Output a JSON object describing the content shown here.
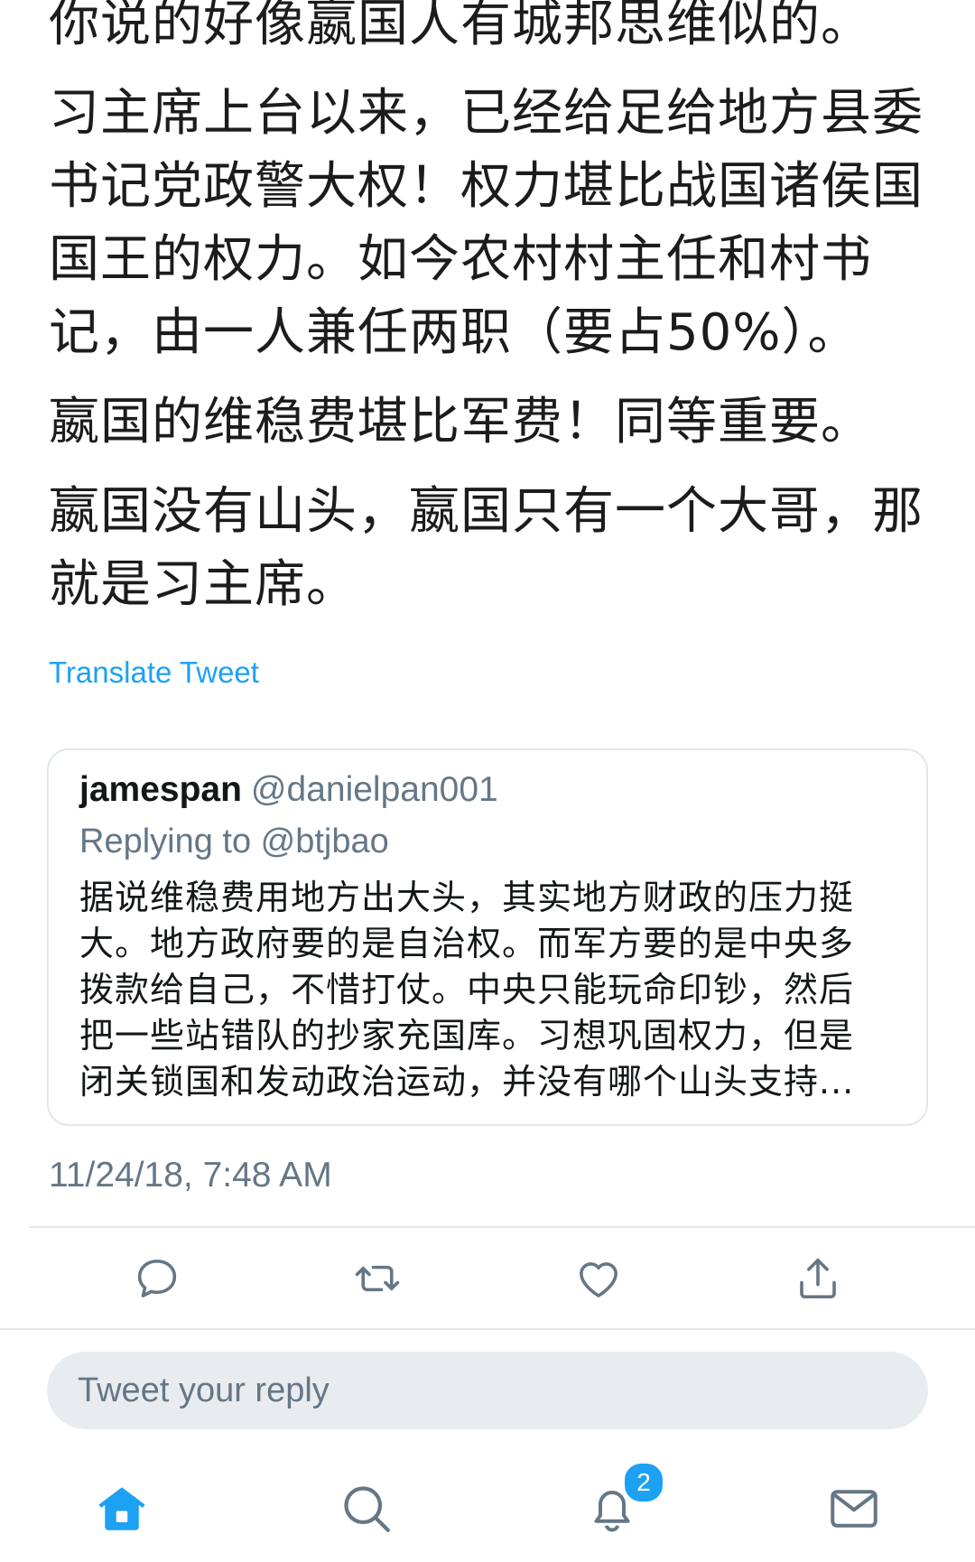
{
  "tweet": {
    "paragraphs": [
      "你说的好像嬴国人有城邦思维似的。",
      "习主席上台以来，已经给足给地方县委书记党政警大权！权力堪比战国诸侯国国王的权力。如今农村村主任和村书记，由一人兼任两职（要占50%）。",
      "嬴国的维稳费堪比军费！同等重要。",
      "嬴国没有山头，嬴国只有一个大哥，那就是习主席。"
    ],
    "translate_label": "Translate Tweet",
    "timestamp": "11/24/18, 7:48 AM"
  },
  "quoted_tweet": {
    "name": "jamespan",
    "handle": "@danielpan001",
    "replying_to": "Replying to @btjbao",
    "text": "据说维稳费用地方出大头，其实地方财政的压力挺大。地方政府要的是自治权。而军方要的是中央多拨款给自己，不惜打仗。中央只能玩命印钞，然后把一些站错队的抄家充国库。习想巩固权力，但是闭关锁国和发动政治运动，并没有哪个山头支持..."
  },
  "actions": {
    "icons": [
      "reply-icon",
      "retweet-icon",
      "like-icon",
      "share-icon"
    ]
  },
  "reply": {
    "placeholder": "Tweet your reply"
  },
  "bottom_nav": {
    "icons": [
      "home-icon",
      "search-icon",
      "notifications-icon",
      "messages-icon"
    ],
    "notification_count": "2",
    "accent_color": "#1da1f2"
  }
}
